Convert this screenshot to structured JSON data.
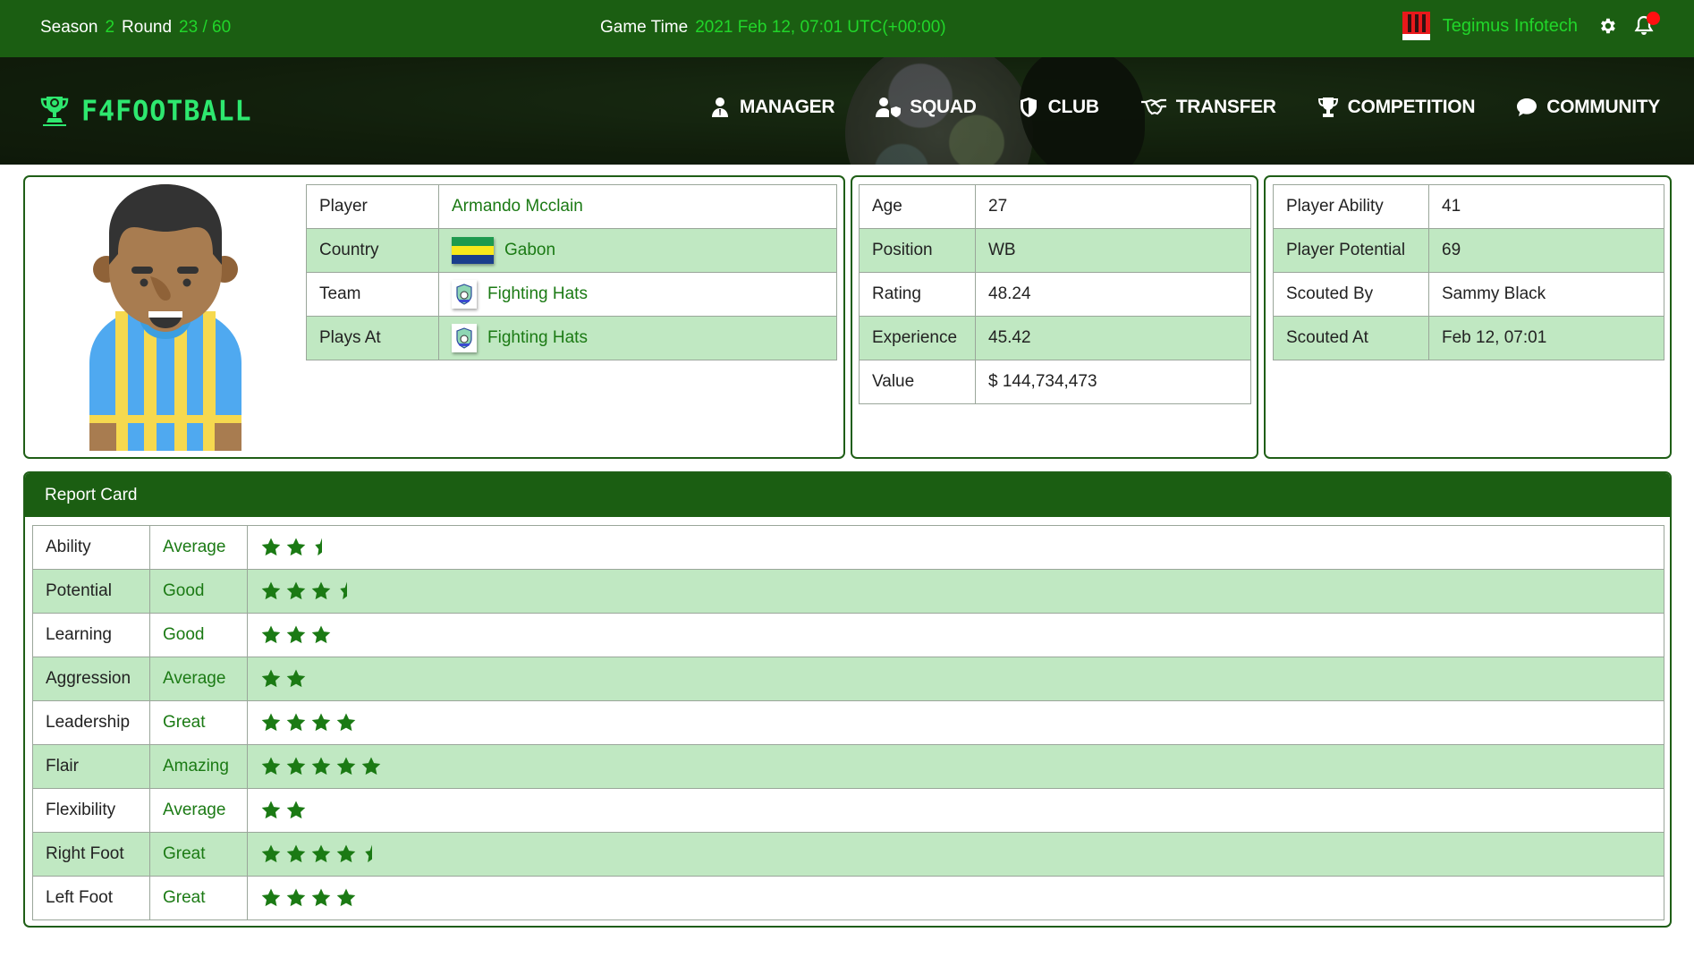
{
  "topbar": {
    "season_label": "Season",
    "season_value": "2",
    "round_label": "Round",
    "round_value": "23 / 60",
    "game_time_label": "Game Time",
    "game_time_value": "2021 Feb 12, 07:01 UTC(+00:00)",
    "company_name": "Tegimus Infotech",
    "notification_badge": true
  },
  "brand": {
    "name": "F4FOOTBALL"
  },
  "nav": [
    {
      "label": "MANAGER",
      "icon": "manager-icon"
    },
    {
      "label": "SQUAD",
      "icon": "squad-icon"
    },
    {
      "label": "CLUB",
      "icon": "shield-icon"
    },
    {
      "label": "TRANSFER",
      "icon": "handshake-icon"
    },
    {
      "label": "COMPETITION",
      "icon": "trophy-icon"
    },
    {
      "label": "COMMUNITY",
      "icon": "chat-icon"
    }
  ],
  "player_info": {
    "rows": [
      {
        "key": "Player",
        "value": "Armando Mcclain"
      },
      {
        "key": "Country",
        "value": "Gabon"
      },
      {
        "key": "Team",
        "value": "Fighting Hats"
      },
      {
        "key": "Plays At",
        "value": "Fighting Hats"
      }
    ],
    "flag_colors": [
      "#1e9a4e",
      "#f8e81c",
      "#1a3e8c"
    ]
  },
  "stats": {
    "rows": [
      {
        "key": "Age",
        "value": "27"
      },
      {
        "key": "Position",
        "value": "WB"
      },
      {
        "key": "Rating",
        "value": "48.24"
      },
      {
        "key": "Experience",
        "value": "45.42"
      },
      {
        "key": "Value",
        "value": "$ 144,734,473"
      }
    ]
  },
  "scouting": {
    "rows": [
      {
        "key": "Player Ability",
        "value": "41"
      },
      {
        "key": "Player Potential",
        "value": "69"
      },
      {
        "key": "Scouted By",
        "value": "Sammy Black"
      },
      {
        "key": "Scouted At",
        "value": "Feb 12, 07:01"
      }
    ]
  },
  "report_card": {
    "title": "Report Card",
    "rows": [
      {
        "attribute": "Ability",
        "grade": "Average",
        "stars": 2.5
      },
      {
        "attribute": "Potential",
        "grade": "Good",
        "stars": 3.5
      },
      {
        "attribute": "Learning",
        "grade": "Good",
        "stars": 3
      },
      {
        "attribute": "Aggression",
        "grade": "Average",
        "stars": 2
      },
      {
        "attribute": "Leadership",
        "grade": "Great",
        "stars": 4
      },
      {
        "attribute": "Flair",
        "grade": "Amazing",
        "stars": 5
      },
      {
        "attribute": "Flexibility",
        "grade": "Average",
        "stars": 2
      },
      {
        "attribute": "Right Foot",
        "grade": "Great",
        "stars": 4.5
      },
      {
        "attribute": "Left Foot",
        "grade": "Great",
        "stars": 4
      }
    ]
  },
  "colors": {
    "primary": "#1b5e12",
    "accent": "#21d62a",
    "row_alt": "#c0e8c2",
    "link": "#1b7a14",
    "star": "#1b7a14",
    "notification": "#ff1010"
  }
}
